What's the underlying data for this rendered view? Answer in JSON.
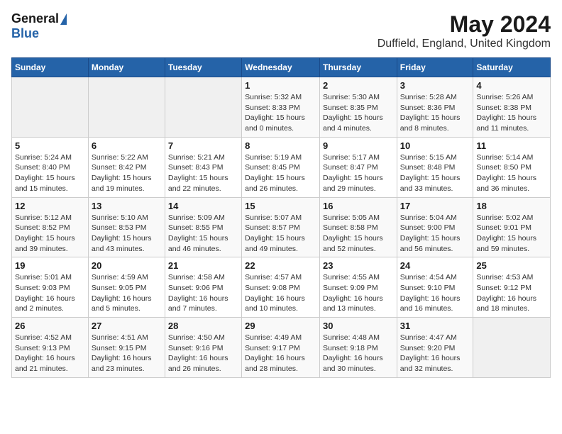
{
  "header": {
    "logo_general": "General",
    "logo_blue": "Blue",
    "month": "May 2024",
    "location": "Duffield, England, United Kingdom"
  },
  "days_of_week": [
    "Sunday",
    "Monday",
    "Tuesday",
    "Wednesday",
    "Thursday",
    "Friday",
    "Saturday"
  ],
  "weeks": [
    [
      {
        "day": "",
        "detail": ""
      },
      {
        "day": "",
        "detail": ""
      },
      {
        "day": "",
        "detail": ""
      },
      {
        "day": "1",
        "detail": "Sunrise: 5:32 AM\nSunset: 8:33 PM\nDaylight: 15 hours\nand 0 minutes."
      },
      {
        "day": "2",
        "detail": "Sunrise: 5:30 AM\nSunset: 8:35 PM\nDaylight: 15 hours\nand 4 minutes."
      },
      {
        "day": "3",
        "detail": "Sunrise: 5:28 AM\nSunset: 8:36 PM\nDaylight: 15 hours\nand 8 minutes."
      },
      {
        "day": "4",
        "detail": "Sunrise: 5:26 AM\nSunset: 8:38 PM\nDaylight: 15 hours\nand 11 minutes."
      }
    ],
    [
      {
        "day": "5",
        "detail": "Sunrise: 5:24 AM\nSunset: 8:40 PM\nDaylight: 15 hours\nand 15 minutes."
      },
      {
        "day": "6",
        "detail": "Sunrise: 5:22 AM\nSunset: 8:42 PM\nDaylight: 15 hours\nand 19 minutes."
      },
      {
        "day": "7",
        "detail": "Sunrise: 5:21 AM\nSunset: 8:43 PM\nDaylight: 15 hours\nand 22 minutes."
      },
      {
        "day": "8",
        "detail": "Sunrise: 5:19 AM\nSunset: 8:45 PM\nDaylight: 15 hours\nand 26 minutes."
      },
      {
        "day": "9",
        "detail": "Sunrise: 5:17 AM\nSunset: 8:47 PM\nDaylight: 15 hours\nand 29 minutes."
      },
      {
        "day": "10",
        "detail": "Sunrise: 5:15 AM\nSunset: 8:48 PM\nDaylight: 15 hours\nand 33 minutes."
      },
      {
        "day": "11",
        "detail": "Sunrise: 5:14 AM\nSunset: 8:50 PM\nDaylight: 15 hours\nand 36 minutes."
      }
    ],
    [
      {
        "day": "12",
        "detail": "Sunrise: 5:12 AM\nSunset: 8:52 PM\nDaylight: 15 hours\nand 39 minutes."
      },
      {
        "day": "13",
        "detail": "Sunrise: 5:10 AM\nSunset: 8:53 PM\nDaylight: 15 hours\nand 43 minutes."
      },
      {
        "day": "14",
        "detail": "Sunrise: 5:09 AM\nSunset: 8:55 PM\nDaylight: 15 hours\nand 46 minutes."
      },
      {
        "day": "15",
        "detail": "Sunrise: 5:07 AM\nSunset: 8:57 PM\nDaylight: 15 hours\nand 49 minutes."
      },
      {
        "day": "16",
        "detail": "Sunrise: 5:05 AM\nSunset: 8:58 PM\nDaylight: 15 hours\nand 52 minutes."
      },
      {
        "day": "17",
        "detail": "Sunrise: 5:04 AM\nSunset: 9:00 PM\nDaylight: 15 hours\nand 56 minutes."
      },
      {
        "day": "18",
        "detail": "Sunrise: 5:02 AM\nSunset: 9:01 PM\nDaylight: 15 hours\nand 59 minutes."
      }
    ],
    [
      {
        "day": "19",
        "detail": "Sunrise: 5:01 AM\nSunset: 9:03 PM\nDaylight: 16 hours\nand 2 minutes."
      },
      {
        "day": "20",
        "detail": "Sunrise: 4:59 AM\nSunset: 9:05 PM\nDaylight: 16 hours\nand 5 minutes."
      },
      {
        "day": "21",
        "detail": "Sunrise: 4:58 AM\nSunset: 9:06 PM\nDaylight: 16 hours\nand 7 minutes."
      },
      {
        "day": "22",
        "detail": "Sunrise: 4:57 AM\nSunset: 9:08 PM\nDaylight: 16 hours\nand 10 minutes."
      },
      {
        "day": "23",
        "detail": "Sunrise: 4:55 AM\nSunset: 9:09 PM\nDaylight: 16 hours\nand 13 minutes."
      },
      {
        "day": "24",
        "detail": "Sunrise: 4:54 AM\nSunset: 9:10 PM\nDaylight: 16 hours\nand 16 minutes."
      },
      {
        "day": "25",
        "detail": "Sunrise: 4:53 AM\nSunset: 9:12 PM\nDaylight: 16 hours\nand 18 minutes."
      }
    ],
    [
      {
        "day": "26",
        "detail": "Sunrise: 4:52 AM\nSunset: 9:13 PM\nDaylight: 16 hours\nand 21 minutes."
      },
      {
        "day": "27",
        "detail": "Sunrise: 4:51 AM\nSunset: 9:15 PM\nDaylight: 16 hours\nand 23 minutes."
      },
      {
        "day": "28",
        "detail": "Sunrise: 4:50 AM\nSunset: 9:16 PM\nDaylight: 16 hours\nand 26 minutes."
      },
      {
        "day": "29",
        "detail": "Sunrise: 4:49 AM\nSunset: 9:17 PM\nDaylight: 16 hours\nand 28 minutes."
      },
      {
        "day": "30",
        "detail": "Sunrise: 4:48 AM\nSunset: 9:18 PM\nDaylight: 16 hours\nand 30 minutes."
      },
      {
        "day": "31",
        "detail": "Sunrise: 4:47 AM\nSunset: 9:20 PM\nDaylight: 16 hours\nand 32 minutes."
      },
      {
        "day": "",
        "detail": ""
      }
    ]
  ]
}
